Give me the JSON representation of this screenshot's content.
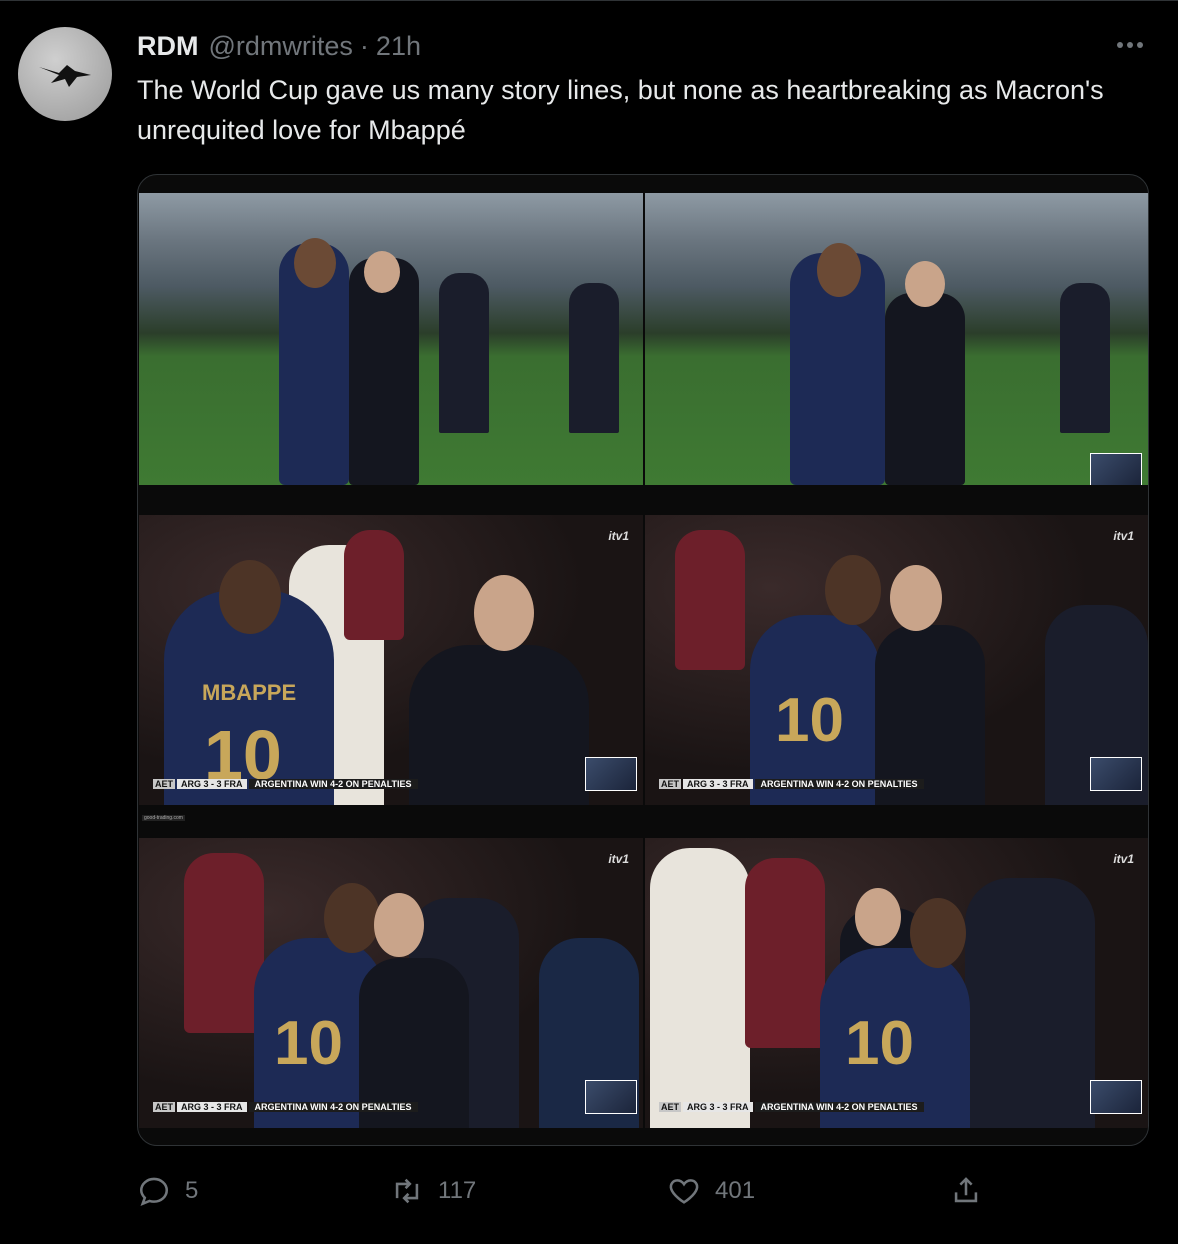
{
  "tweet": {
    "display_name": "RDM",
    "handle": "@rdmwrites",
    "separator": "·",
    "time": "21h",
    "text": "The World Cup gave us many story lines, but none as heartbreaking as Macron's unrequited love for Mbappé",
    "avatar_icon": "bird-silhouette-icon",
    "more_icon": "more-dots-icon"
  },
  "media": {
    "broadcaster": "itv1",
    "jersey_name": "MBAPPE",
    "overlay": {
      "aet": "AET",
      "score": "ARG 3 - 3 FRA",
      "result": "ARGENTINA WIN 4-2 ON PENALTIES"
    },
    "watermark": "good-trading.com"
  },
  "actions": {
    "reply_count": "5",
    "retweet_count": "117",
    "like_count": "401"
  },
  "colors": {
    "background": "#000000",
    "text": "#e7e9ea",
    "muted": "#71767b",
    "border": "#2f3336",
    "france_blue": "#1d2a55"
  }
}
